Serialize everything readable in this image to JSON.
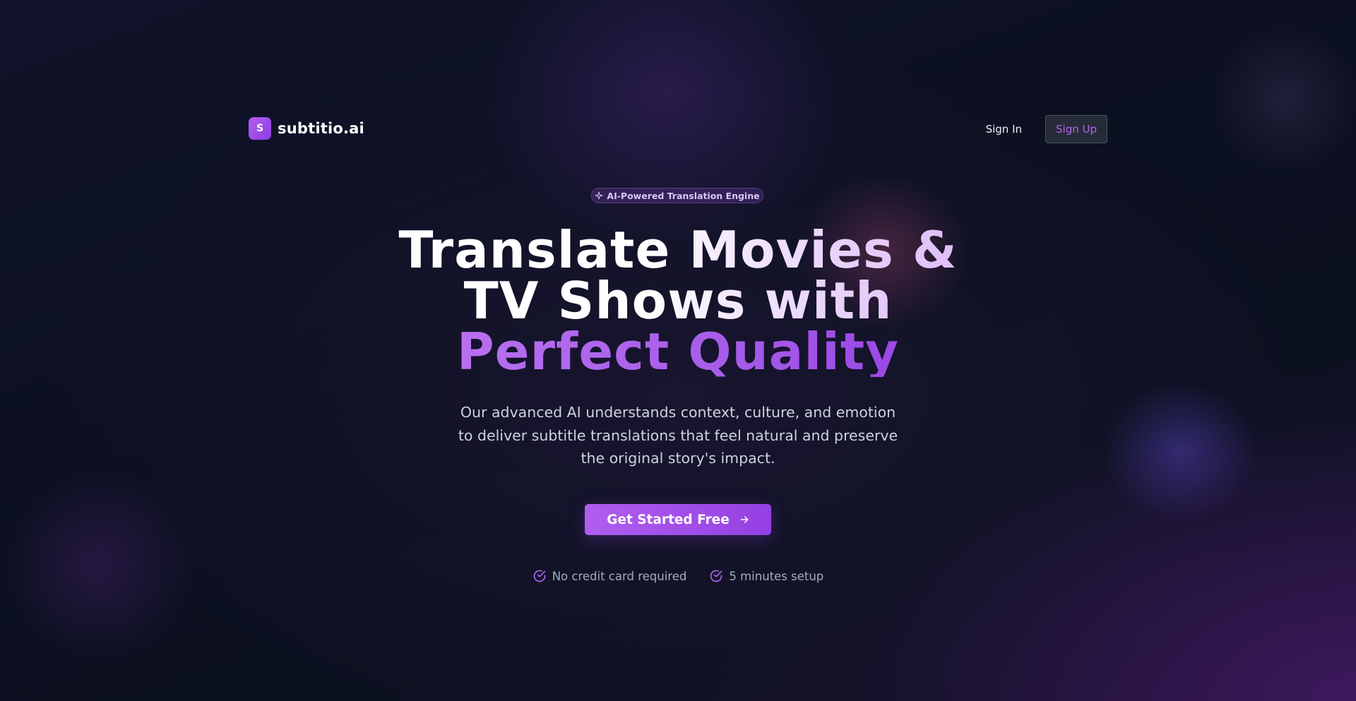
{
  "header": {
    "logo_letter": "S",
    "brand_name": "subtitio.ai",
    "signin_label": "Sign In",
    "signup_label": "Sign Up"
  },
  "hero": {
    "badge_icon": "sparkle-icon",
    "badge_text": "AI-Powered Translation Engine",
    "headline_line1": "Translate Movies &",
    "headline_line2": "TV Shows with",
    "headline_line3": "Perfect Quality",
    "subtext": "Our advanced AI understands context, culture, and emotion to deliver subtitle translations that feel natural and preserve the original story's impact.",
    "cta_label": "Get Started Free",
    "cta_icon": "arrow-right-icon"
  },
  "features": [
    {
      "icon": "check-circle-icon",
      "label": "No credit card required"
    },
    {
      "icon": "check-circle-icon",
      "label": "5 minutes setup"
    }
  ],
  "colors": {
    "accent": "#a855f7",
    "background": "#0b0f1c",
    "text_primary": "#ffffff",
    "text_muted": "#a6abb8"
  }
}
